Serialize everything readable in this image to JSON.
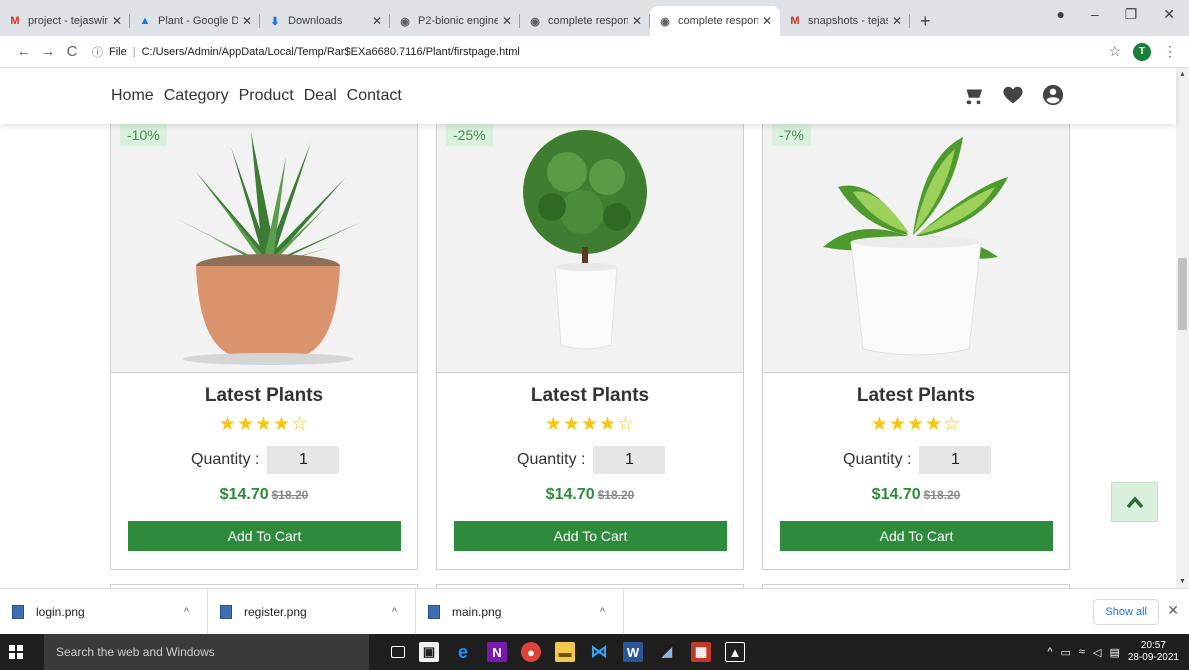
{
  "browser": {
    "tabs": [
      {
        "title": "project - tejaswin",
        "favicon": "gmail-icon",
        "color": "#d93025",
        "active": false
      },
      {
        "title": "Plant - Google Dr",
        "favicon": "drive-icon",
        "color": "#1a73e8",
        "active": false
      },
      {
        "title": "Downloads",
        "favicon": "download-icon",
        "color": "#1a73e8",
        "active": false
      },
      {
        "title": "P2-bionic engine",
        "favicon": "globe-icon",
        "color": "#5f6368",
        "active": false
      },
      {
        "title": "complete respon",
        "favicon": "globe-icon",
        "color": "#5f6368",
        "active": false
      },
      {
        "title": "complete respon",
        "favicon": "globe-icon",
        "color": "#5f6368",
        "active": true
      },
      {
        "title": "snapshots - tejas",
        "favicon": "gmail-icon",
        "color": "#d93025",
        "active": false
      }
    ],
    "new_tab": "+",
    "address": {
      "scheme": "File",
      "url": "C:/Users/Admin/AppData/Local/Temp/Rar$EXa6680.7116/Plant/firstpage.html"
    },
    "avatar_letter": "T"
  },
  "site": {
    "nav": [
      "Home",
      "Category",
      "Product",
      "Deal",
      "Contact"
    ],
    "accent": "#2e8b3c",
    "cards": [
      {
        "discount": "-10%",
        "title": "Latest Plants",
        "stars": "★★★★☆",
        "rating": 4,
        "qty_label": "Quantity :",
        "qty": "1",
        "price": "$14.70",
        "old_price": "$18.20",
        "button": "Add To Cart",
        "plant": "aloe"
      },
      {
        "discount": "-25%",
        "title": "Latest Plants",
        "stars": "★★★★☆",
        "rating": 4,
        "qty_label": "Quantity :",
        "qty": "1",
        "price": "$14.70",
        "old_price": "$18.20",
        "button": "Add To Cart",
        "plant": "topiary"
      },
      {
        "discount": "-7%",
        "title": "Latest Plants",
        "stars": "★★★★☆",
        "rating": 4,
        "qty_label": "Quantity :",
        "qty": "1",
        "price": "$14.70",
        "old_price": "$18.20",
        "button": "Add To Cart",
        "plant": "dieffenbachia"
      }
    ]
  },
  "downloads": {
    "items": [
      "login.png",
      "register.png",
      "main.png"
    ],
    "show_all": "Show all"
  },
  "taskbar": {
    "search_placeholder": "Search the web and Windows",
    "time": "20:57",
    "date": "28-09-2021"
  }
}
